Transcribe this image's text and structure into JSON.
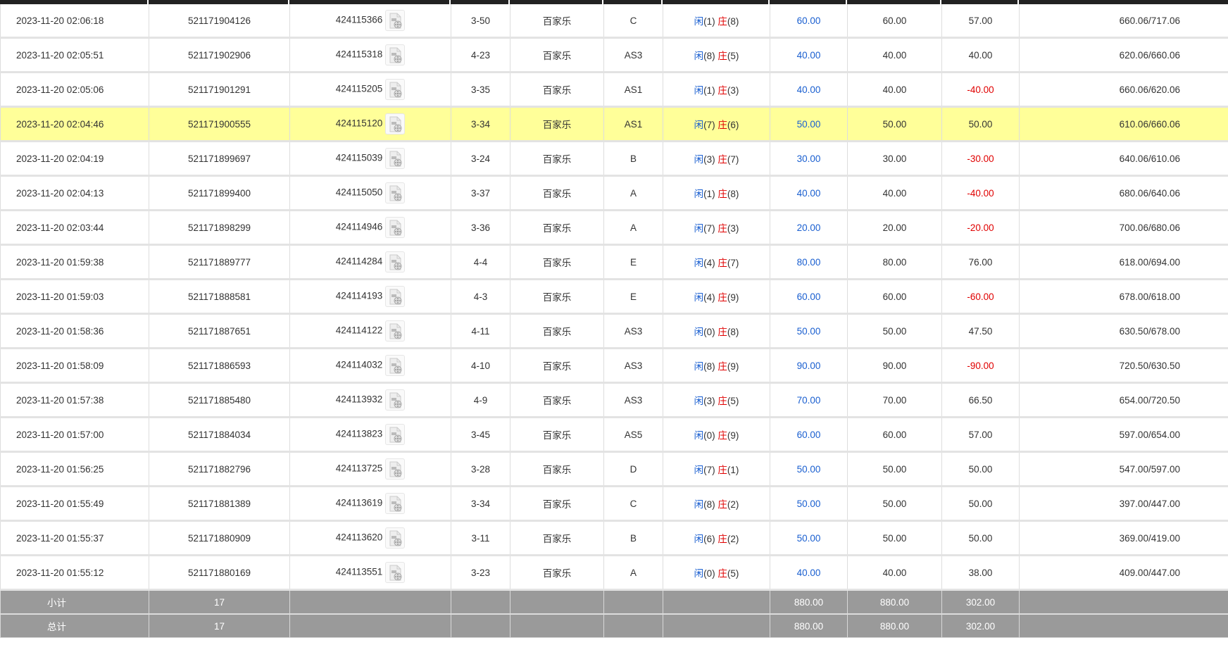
{
  "colors": {
    "highlight": "#ffff99",
    "player": "#1a5fd0",
    "banker": "#e00000",
    "loss": "#e00000",
    "total_bg": "#9a9a9a"
  },
  "result_labels": {
    "player": "闲",
    "banker": "庄"
  },
  "rows": [
    {
      "time": "2023-11-20 02:06:18",
      "order": "521171904126",
      "round": "424115366",
      "table": "3-50",
      "game": "百家乐",
      "bet": "C",
      "p": "(1)",
      "b": "(8)",
      "amount": "60.00",
      "valid": "60.00",
      "win": "57.00",
      "balance": "660.06/717.06"
    },
    {
      "time": "2023-11-20 02:05:51",
      "order": "521171902906",
      "round": "424115318",
      "table": "4-23",
      "game": "百家乐",
      "bet": "AS3",
      "p": "(8)",
      "b": "(5)",
      "amount": "40.00",
      "valid": "40.00",
      "win": "40.00",
      "balance": "620.06/660.06"
    },
    {
      "time": "2023-11-20 02:05:06",
      "order": "521171901291",
      "round": "424115205",
      "table": "3-35",
      "game": "百家乐",
      "bet": "AS1",
      "p": "(1)",
      "b": "(3)",
      "amount": "40.00",
      "valid": "40.00",
      "win": "-40.00",
      "balance": "660.06/620.06"
    },
    {
      "time": "2023-11-20 02:04:46",
      "order": "521171900555",
      "round": "424115120",
      "table": "3-34",
      "game": "百家乐",
      "bet": "AS1",
      "p": "(7)",
      "b": "(6)",
      "amount": "50.00",
      "valid": "50.00",
      "win": "50.00",
      "balance": "610.06/660.06",
      "highlight": true
    },
    {
      "time": "2023-11-20 02:04:19",
      "order": "521171899697",
      "round": "424115039",
      "table": "3-24",
      "game": "百家乐",
      "bet": "B",
      "p": "(3)",
      "b": "(7)",
      "amount": "30.00",
      "valid": "30.00",
      "win": "-30.00",
      "balance": "640.06/610.06"
    },
    {
      "time": "2023-11-20 02:04:13",
      "order": "521171899400",
      "round": "424115050",
      "table": "3-37",
      "game": "百家乐",
      "bet": "A",
      "p": "(1)",
      "b": "(8)",
      "amount": "40.00",
      "valid": "40.00",
      "win": "-40.00",
      "balance": "680.06/640.06"
    },
    {
      "time": "2023-11-20 02:03:44",
      "order": "521171898299",
      "round": "424114946",
      "table": "3-36",
      "game": "百家乐",
      "bet": "A",
      "p": "(7)",
      "b": "(3)",
      "amount": "20.00",
      "valid": "20.00",
      "win": "-20.00",
      "balance": "700.06/680.06"
    },
    {
      "time": "2023-11-20 01:59:38",
      "order": "521171889777",
      "round": "424114284",
      "table": "4-4",
      "game": "百家乐",
      "bet": "E",
      "p": "(4)",
      "b": "(7)",
      "amount": "80.00",
      "valid": "80.00",
      "win": "76.00",
      "balance": "618.00/694.00"
    },
    {
      "time": "2023-11-20 01:59:03",
      "order": "521171888581",
      "round": "424114193",
      "table": "4-3",
      "game": "百家乐",
      "bet": "E",
      "p": "(4)",
      "b": "(9)",
      "amount": "60.00",
      "valid": "60.00",
      "win": "-60.00",
      "balance": "678.00/618.00"
    },
    {
      "time": "2023-11-20 01:58:36",
      "order": "521171887651",
      "round": "424114122",
      "table": "4-11",
      "game": "百家乐",
      "bet": "AS3",
      "p": "(0)",
      "b": "(8)",
      "amount": "50.00",
      "valid": "50.00",
      "win": "47.50",
      "balance": "630.50/678.00"
    },
    {
      "time": "2023-11-20 01:58:09",
      "order": "521171886593",
      "round": "424114032",
      "table": "4-10",
      "game": "百家乐",
      "bet": "AS3",
      "p": "(8)",
      "b": "(9)",
      "amount": "90.00",
      "valid": "90.00",
      "win": "-90.00",
      "balance": "720.50/630.50"
    },
    {
      "time": "2023-11-20 01:57:38",
      "order": "521171885480",
      "round": "424113932",
      "table": "4-9",
      "game": "百家乐",
      "bet": "AS3",
      "p": "(3)",
      "b": "(5)",
      "amount": "70.00",
      "valid": "70.00",
      "win": "66.50",
      "balance": "654.00/720.50"
    },
    {
      "time": "2023-11-20 01:57:00",
      "order": "521171884034",
      "round": "424113823",
      "table": "3-45",
      "game": "百家乐",
      "bet": "AS5",
      "p": "(0)",
      "b": "(9)",
      "amount": "60.00",
      "valid": "60.00",
      "win": "57.00",
      "balance": "597.00/654.00"
    },
    {
      "time": "2023-11-20 01:56:25",
      "order": "521171882796",
      "round": "424113725",
      "table": "3-28",
      "game": "百家乐",
      "bet": "D",
      "p": "(7)",
      "b": "(1)",
      "amount": "50.00",
      "valid": "50.00",
      "win": "50.00",
      "balance": "547.00/597.00"
    },
    {
      "time": "2023-11-20 01:55:49",
      "order": "521171881389",
      "round": "424113619",
      "table": "3-34",
      "game": "百家乐",
      "bet": "C",
      "p": "(8)",
      "b": "(2)",
      "amount": "50.00",
      "valid": "50.00",
      "win": "50.00",
      "balance": "397.00/447.00"
    },
    {
      "time": "2023-11-20 01:55:37",
      "order": "521171880909",
      "round": "424113620",
      "table": "3-11",
      "game": "百家乐",
      "bet": "B",
      "p": "(6)",
      "b": "(2)",
      "amount": "50.00",
      "valid": "50.00",
      "win": "50.00",
      "balance": "369.00/419.00"
    },
    {
      "time": "2023-11-20 01:55:12",
      "order": "521171880169",
      "round": "424113551",
      "table": "3-23",
      "game": "百家乐",
      "bet": "A",
      "p": "(0)",
      "b": "(5)",
      "amount": "40.00",
      "valid": "40.00",
      "win": "38.00",
      "balance": "409.00/447.00"
    }
  ],
  "totals": [
    {
      "label": "小计",
      "count": "17",
      "amount": "880.00",
      "valid": "880.00",
      "win": "302.00"
    },
    {
      "label": "总计",
      "count": "17",
      "amount": "880.00",
      "valid": "880.00",
      "win": "302.00"
    }
  ]
}
